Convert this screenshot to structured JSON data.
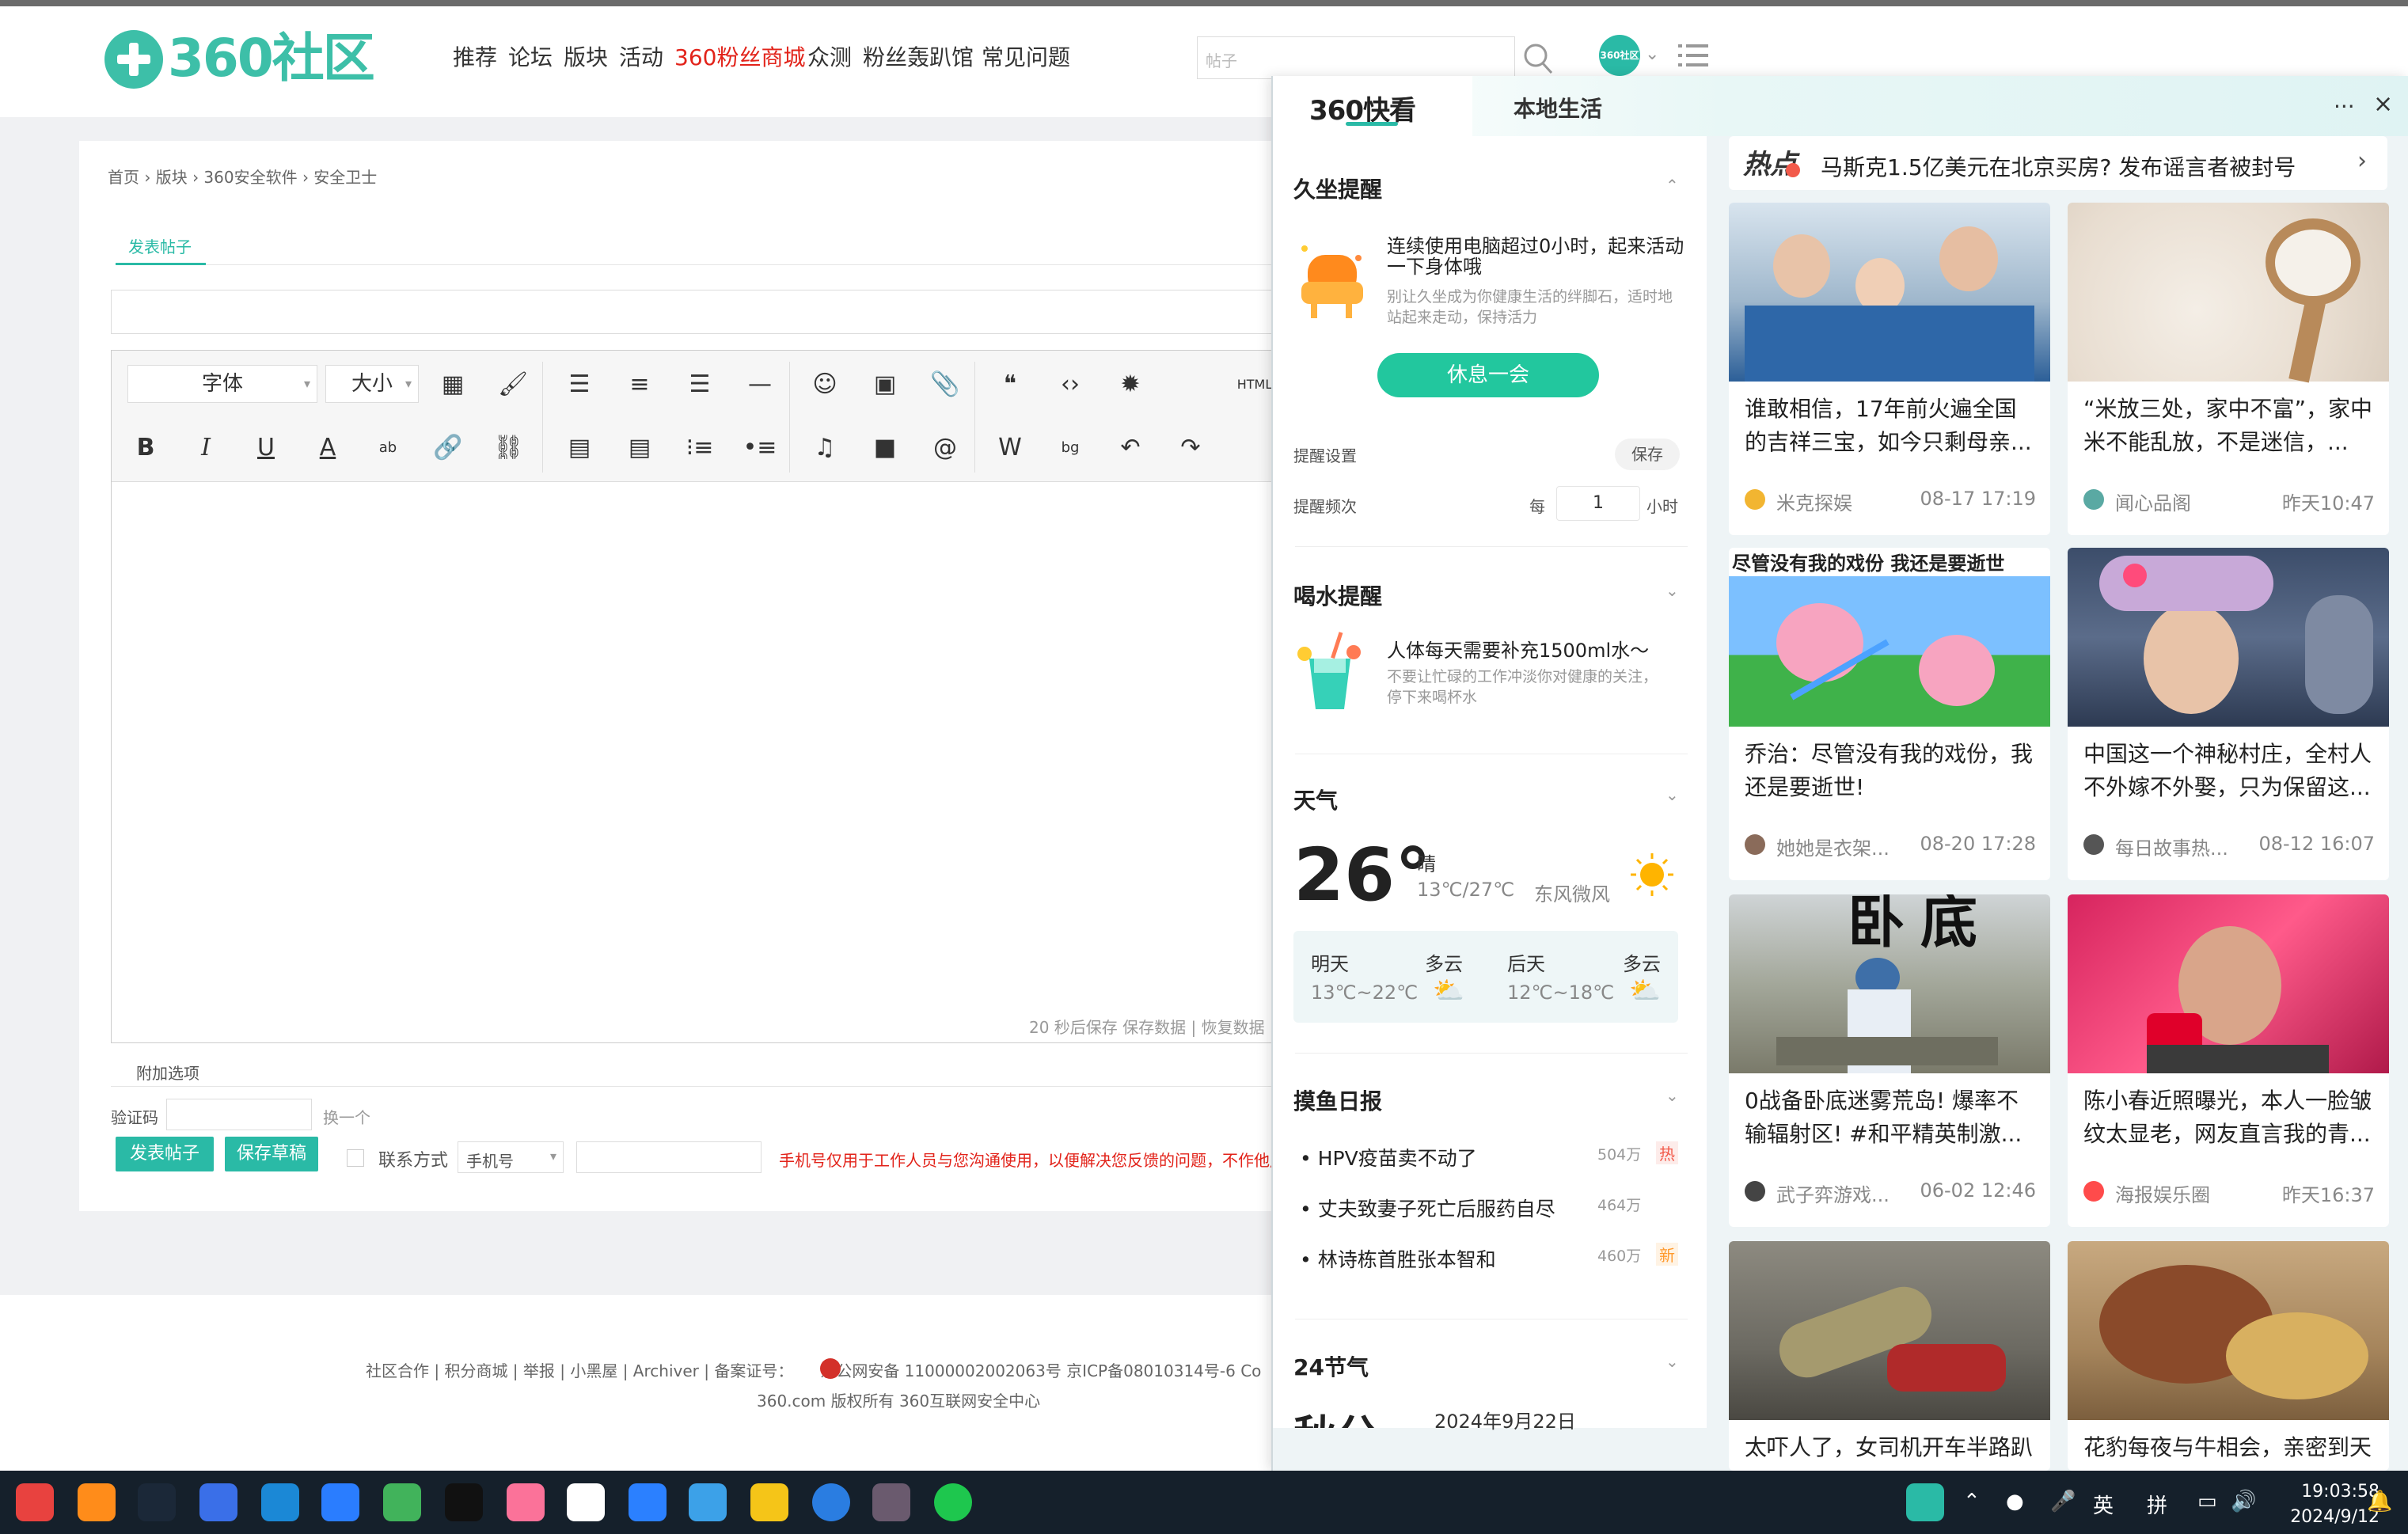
{
  "nav": {
    "logo_text": "360社区",
    "items": [
      {
        "label": "推荐",
        "highlight": false
      },
      {
        "label": "论坛",
        "highlight": false
      },
      {
        "label": "版块",
        "highlight": false
      },
      {
        "label": "活动",
        "highlight": false
      },
      {
        "label": "360粉丝商城",
        "highlight": true
      },
      {
        "label": "众测",
        "highlight": false
      },
      {
        "label": "粉丝轰趴馆",
        "highlight": false
      },
      {
        "label": "常见问题",
        "highlight": false
      }
    ],
    "search_placeholder": "帖子",
    "avatar_text": "360社区"
  },
  "breadcrumb": "首页 › 版块 › 360安全软件 › 安全卫士",
  "post": {
    "tab_label": "发表帖子",
    "font_select": "字体",
    "size_select": "大小",
    "html_label": "HTML",
    "editor_status": "20 秒后保存 保存数据 | 恢复数据",
    "extra_options": "附加选项",
    "captcha_label": "验证码",
    "captcha_refresh": "换一个",
    "submit_label": "发表帖子",
    "draft_label": "保存草稿",
    "contact_label": "联系方式",
    "phone_select": "手机号",
    "phone_note": "手机号仅用于工作人员与您沟通使用，以便解决您反馈的问题，不作他用"
  },
  "footer": {
    "links": "社区合作 | 积分商城 | 举报 | 小黑屋 | Archiver | 备案证号：",
    "icp": "京公网安备 11000002002063号 京ICP备08010314号-6 Co",
    "copyright": "360.com 版权所有 360互联网安全中心"
  },
  "panel": {
    "tab_kuaikan": "360快看",
    "tab_local": "本地生活",
    "more": "···",
    "close": "×",
    "sitting": {
      "title": "久坐提醒",
      "headline": "连续使用电脑超过0小时，起来活动一下身体哦",
      "desc": "别让久坐成为你健康生活的绊脚石，适时地站起来走动，保持活力",
      "button": "休息一会",
      "settings_label": "提醒设置",
      "save_label": "保存",
      "freq_label": "提醒频次",
      "freq_prefix": "每",
      "freq_value": "1",
      "freq_unit": "小时"
    },
    "water": {
      "title": "喝水提醒",
      "headline": "人体每天需要补充1500ml水～",
      "desc": "不要让忙碌的工作冲淡你对健康的关注，停下来喝杯水"
    },
    "weather": {
      "title": "天气",
      "temp": "26°",
      "condition": "晴",
      "range": "13℃/27℃",
      "wind": "东风微风",
      "tomorrow_label": "明天",
      "tomorrow_cond": "多云",
      "tomorrow_range": "13℃~22℃",
      "after_label": "后天",
      "after_cond": "多云",
      "after_range": "12℃~18℃"
    },
    "moyu": {
      "title": "摸鱼日报",
      "items": [
        {
          "text": "HPV疫苗卖不动了",
          "count": "504万",
          "badge": "热"
        },
        {
          "text": "丈夫致妻子死亡后服药自尽",
          "count": "464万",
          "badge": ""
        },
        {
          "text": "林诗栋首胜张本智和",
          "count": "460万",
          "badge": "新"
        }
      ]
    },
    "solar": {
      "title": "24节气",
      "term": "秋分",
      "date": "2024年9月22日"
    },
    "hot": {
      "label": "热点",
      "text": "马斯克1.5亿美元在北京买房? 发布谣言者被封号"
    },
    "cards": [
      {
        "title": "谁敢相信，17年前火遍全国的吉祥三宝，如今只剩母亲...",
        "source": "米克探娱",
        "time": "08-17 17:19"
      },
      {
        "title": "“米放三处，家中不富”，家中米不能乱放，不是迷信，...",
        "source": "闻心品阁",
        "time": "昨天10:47"
      },
      {
        "title": "乔治：尽管没有我的戏份，我还是要逝世!",
        "source": "她她是衣架...",
        "time": "08-20 17:28",
        "caption": "尽管没有我的戏份 我还是要逝世"
      },
      {
        "title": "中国这一个神秘村庄，全村人不外嫁不外娶，只为保留这...",
        "source": "每日故事热...",
        "time": "08-12 16:07"
      },
      {
        "title": "0战备卧底迷雾荒岛! 爆率不输辐射区! #和平精英制激...",
        "source": "武子弈游戏...",
        "time": "06-02 12:46",
        "caption": "卧底"
      },
      {
        "title": "陈小春近照曝光，本人一脸皱纹太显老，网友直言我的青...",
        "source": "海报娱乐圈",
        "time": "昨天16:37"
      },
      {
        "title": "太吓人了，女司机开车半路趴",
        "source": "",
        "time": ""
      },
      {
        "title": "花豹每夜与牛相会，亲密到天",
        "source": "",
        "time": ""
      }
    ]
  },
  "taskbar": {
    "time": "19:03:58",
    "date": "2024/9/12",
    "ime1": "英",
    "ime2": "拼"
  }
}
